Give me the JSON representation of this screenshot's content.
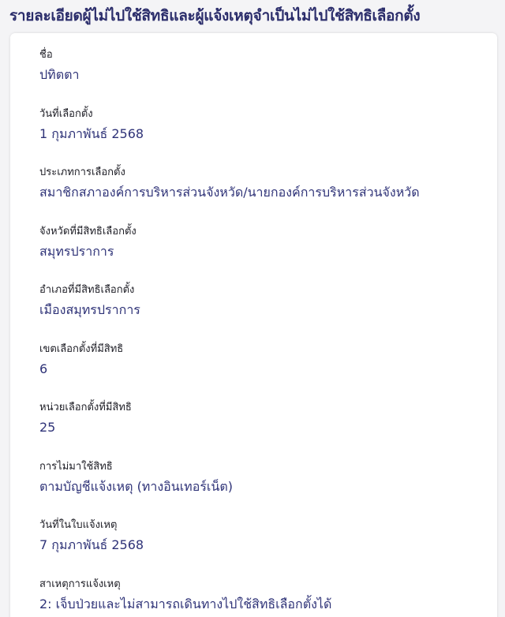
{
  "header": {
    "title": "รายละเอียดผู้ไม่ไปใช้สิทธิและผู้แจ้งเหตุจำเป็นไม่ไปใช้สิทธิเลือกตั้ง"
  },
  "fields": [
    {
      "label": "ชื่อ",
      "value": "ปทิตตา"
    },
    {
      "label": "วันที่เลือกตั้ง",
      "value": "1 กุมภาพันธ์ 2568"
    },
    {
      "label": "ประเภทการเลือกตั้ง",
      "value": "สมาชิกสภาองค์การบริหารส่วนจังหวัด/นายกองค์การบริหารส่วนจังหวัด"
    },
    {
      "label": "จังหวัดที่มีสิทธิเลือกตั้ง",
      "value": "สมุทรปราการ"
    },
    {
      "label": "อำเภอที่มีสิทธิเลือกตั้ง",
      "value": "เมืองสมุทรปราการ"
    },
    {
      "label": "เขตเลือกตั้งที่มีสิทธิ",
      "value": "6"
    },
    {
      "label": "หน่วยเลือกตั้งที่มีสิทธิ",
      "value": "25"
    },
    {
      "label": "การไม่มาใช้สิทธิ",
      "value": "ตามบัญชีแจ้งเหตุ (ทางอินเทอร์เน็ต)"
    },
    {
      "label": "วันที่ในใบแจ้งเหตุ",
      "value": "7 กุมภาพันธ์ 2568"
    },
    {
      "label": "สาเหตุการแจ้งเหตุ",
      "value": "2: เจ็บป่วยและไม่สามารถเดินทางไปใช้สิทธิเลือกตั้งได้"
    }
  ],
  "colors": {
    "title": "#2b2d6b",
    "label": "#1c1c24",
    "value": "#2f3378",
    "background": "#f4f4f6",
    "card": "#ffffff"
  }
}
